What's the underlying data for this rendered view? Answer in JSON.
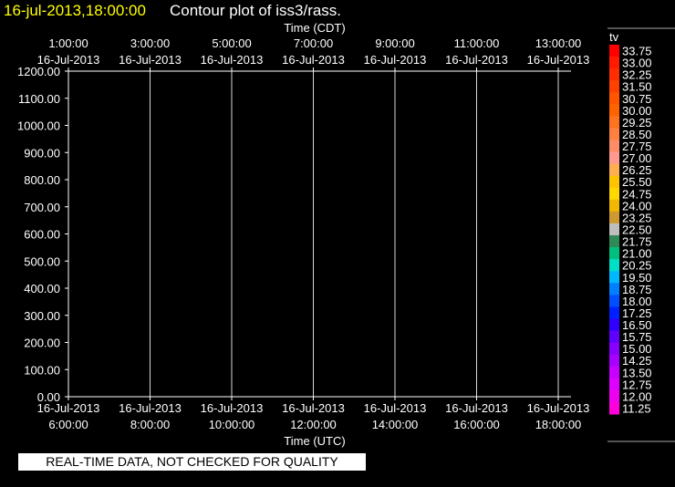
{
  "header": {
    "date_time": "16-jul-2013,18:00:00",
    "title": "Contour plot of iss3/rass."
  },
  "footer": {
    "quality_note": "REAL-TIME DATA, NOT CHECKED FOR QUALITY"
  },
  "chart_data": {
    "type": "heatmap",
    "title": "Contour plot of iss3/rass.",
    "top_axis": {
      "label": "Time (CDT)",
      "ticks": [
        {
          "time": "1:00:00",
          "date": "16-Jul-2013"
        },
        {
          "time": "3:00:00",
          "date": "16-Jul-2013"
        },
        {
          "time": "5:00:00",
          "date": "16-Jul-2013"
        },
        {
          "time": "7:00:00",
          "date": "16-Jul-2013"
        },
        {
          "time": "9:00:00",
          "date": "16-Jul-2013"
        },
        {
          "time": "11:00:00",
          "date": "16-Jul-2013"
        },
        {
          "time": "13:00:00",
          "date": "16-Jul-2013"
        }
      ]
    },
    "bottom_axis": {
      "label": "Time (UTC)",
      "ticks": [
        {
          "date": "16-Jul-2013",
          "time": "6:00:00"
        },
        {
          "date": "16-Jul-2013",
          "time": "8:00:00"
        },
        {
          "date": "16-Jul-2013",
          "time": "10:00:00"
        },
        {
          "date": "16-Jul-2013",
          "time": "12:00:00"
        },
        {
          "date": "16-Jul-2013",
          "time": "14:00:00"
        },
        {
          "date": "16-Jul-2013",
          "time": "16:00:00"
        },
        {
          "date": "16-Jul-2013",
          "time": "18:00:00"
        }
      ]
    },
    "y_axis": {
      "ylim": [
        0,
        1200
      ],
      "ticks": [
        "0.00",
        "100.00",
        "200.00",
        "300.00",
        "400.00",
        "500.00",
        "600.00",
        "700.00",
        "800.00",
        "900.00",
        "1000.00",
        "1100.00",
        "1200.00"
      ]
    },
    "vertical_gridlines": true,
    "data": [],
    "colorbar": {
      "label": "tv",
      "levels": [
        {
          "value": "33.75",
          "color": "#ff0000"
        },
        {
          "value": "33.00",
          "color": "#ff1a00"
        },
        {
          "value": "32.25",
          "color": "#ff2d00"
        },
        {
          "value": "31.50",
          "color": "#ff4100"
        },
        {
          "value": "30.75",
          "color": "#ff5400"
        },
        {
          "value": "30.00",
          "color": "#ff6300"
        },
        {
          "value": "29.25",
          "color": "#ff7320"
        },
        {
          "value": "28.50",
          "color": "#ff8040"
        },
        {
          "value": "27.75",
          "color": "#ff8c68"
        },
        {
          "value": "27.00",
          "color": "#ff9a90"
        },
        {
          "value": "26.25",
          "color": "#ffae50"
        },
        {
          "value": "25.50",
          "color": "#ffc400"
        },
        {
          "value": "24.75",
          "color": "#ffd800"
        },
        {
          "value": "24.00",
          "color": "#f0b800"
        },
        {
          "value": "23.25",
          "color": "#cc9a30"
        },
        {
          "value": "22.50",
          "color": "#bebebe"
        },
        {
          "value": "21.75",
          "color": "#2e8b57"
        },
        {
          "value": "21.00",
          "color": "#00c080"
        },
        {
          "value": "20.25",
          "color": "#00e0c8"
        },
        {
          "value": "19.50",
          "color": "#00b8ff"
        },
        {
          "value": "18.75",
          "color": "#0080ff"
        },
        {
          "value": "18.00",
          "color": "#0050ff"
        },
        {
          "value": "17.25",
          "color": "#0020ff"
        },
        {
          "value": "16.50",
          "color": "#3000ff"
        },
        {
          "value": "15.75",
          "color": "#6000ff"
        },
        {
          "value": "15.00",
          "color": "#8800ff"
        },
        {
          "value": "14.25",
          "color": "#a800ff"
        },
        {
          "value": "13.50",
          "color": "#c800ff"
        },
        {
          "value": "12.75",
          "color": "#e000ff"
        },
        {
          "value": "12.00",
          "color": "#f000f0"
        },
        {
          "value": "11.25",
          "color": "#ff00dd"
        }
      ]
    }
  }
}
